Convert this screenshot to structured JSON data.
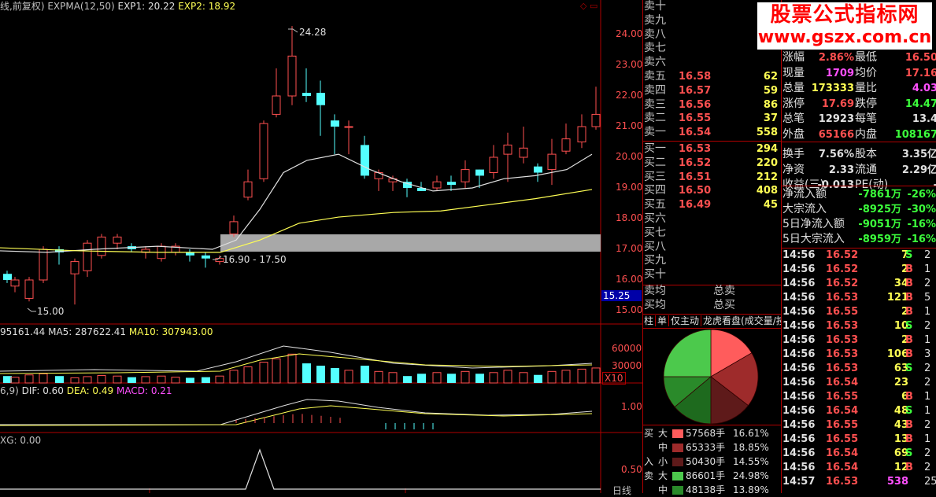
{
  "header": {
    "kline_title": "线,前复权)",
    "expma": "EXPMA(12,50)",
    "exp1": "EXP1: 20.22",
    "exp2": "EXP2: 18.92",
    "vol_title": "95161.44",
    "vol_ma5": "MA5: 287622.41",
    "vol_ma10": "MA10: 307943.00",
    "macd_prefix": "6,9)",
    "macd_dif": "DIF: 0.60",
    "macd_dea": "DEA: 0.49",
    "macd_macd": "MACD: 0.21",
    "xg": "XG: 0.00"
  },
  "price_axis": [
    "24.00",
    "23.00",
    "22.00",
    "21.00",
    "20.00",
    "19.00",
    "18.00",
    "17.00",
    "16.00",
    "15.00"
  ],
  "price_axis_highlight": "15.25",
  "annotations": {
    "high": "24.28",
    "low": "15.00",
    "range": "16.90 - 17.50"
  },
  "vol_axis": [
    "60000",
    "30000"
  ],
  "vol_unit": "X10",
  "macd_axis": "1.00",
  "xg_axis": "0.50",
  "xg_bottom_label": "日线",
  "watermark": {
    "line1": "股票公式指标网",
    "line2": "www.gszx.com.cn"
  },
  "order_book": {
    "sell_labels": [
      "卖十",
      "卖九",
      "卖八",
      "卖七",
      "卖六",
      "卖五",
      "卖四",
      "卖三",
      "卖二",
      "卖一"
    ],
    "sell_prices": [
      "",
      "",
      "",
      "",
      "",
      "16.58",
      "16.57",
      "16.56",
      "16.55",
      "16.54"
    ],
    "sell_vols": [
      "",
      "",
      "",
      "",
      "",
      "62",
      "59",
      "86",
      "37",
      "558"
    ],
    "buy_labels": [
      "买一",
      "买二",
      "买三",
      "买四",
      "买五",
      "买六",
      "买七",
      "买八",
      "买九",
      "买十"
    ],
    "buy_prices": [
      "16.53",
      "16.52",
      "16.51",
      "16.50",
      "16.49",
      "",
      "",
      "",
      "",
      ""
    ],
    "buy_vols": [
      "294",
      "220",
      "212",
      "408",
      "45",
      "",
      "",
      "",
      "",
      ""
    ],
    "sell_avg": "卖均",
    "buy_avg": "买均",
    "total_sell": "总卖",
    "total_buy": "总买"
  },
  "tabs": [
    "柱",
    "单",
    "仅主动",
    "龙虎看盘(成交量/按"
  ],
  "pie_legend": [
    {
      "side": "买",
      "size": "大",
      "amount": "57568手",
      "pct": "16.61%",
      "color": "#ff5c5c"
    },
    {
      "side": "",
      "size": "中",
      "amount": "65333手",
      "pct": "18.85%",
      "color": "#9e2b2b"
    },
    {
      "side": "入",
      "size": "小",
      "amount": "50430手",
      "pct": "14.55%",
      "color": "#5e1a1a"
    },
    {
      "side": "卖",
      "size": "大",
      "amount": "86601手",
      "pct": "24.98%",
      "color": "#4cc94c"
    },
    {
      "side": "",
      "size": "中",
      "amount": "48138手",
      "pct": "13.89%",
      "color": "#2a8a2a"
    }
  ],
  "info_rows": [
    {
      "l1": "涨幅",
      "v1": "2.86%",
      "c1": "red",
      "l2": "最低",
      "v2": "16.50",
      "c2": "red"
    },
    {
      "l1": "现量",
      "v1": "1709",
      "c1": "purple",
      "l2": "均价",
      "v2": "17.16",
      "c2": "red"
    },
    {
      "l1": "总量",
      "v1": "173333",
      "c1": "yellow",
      "l2": "量比",
      "v2": "4.03",
      "c2": "purple"
    },
    {
      "l1": "涨停",
      "v1": "17.69",
      "c1": "red",
      "l2": "跌停",
      "v2": "14.47",
      "c2": "green"
    },
    {
      "l1": "总笔",
      "v1": "12923",
      "c1": "white",
      "l2": "每笔",
      "v2": "13.4",
      "c2": "white"
    },
    {
      "l1": "外盘",
      "v1": "65166",
      "c1": "red",
      "l2": "内盘",
      "v2": "108167",
      "c2": "green"
    },
    {
      "l1": "换手",
      "v1": "7.56%",
      "c1": "white",
      "l2": "股本",
      "v2": "3.35亿",
      "c2": "white"
    },
    {
      "l1": "净资",
      "v1": "2.33",
      "c1": "white",
      "l2": "流通",
      "v2": "2.29亿",
      "c2": "white"
    },
    {
      "l1": "收益(三)",
      "v1": "-0.013",
      "c1": "white",
      "l2": "PE(动)",
      "v2": "-",
      "c2": "white"
    }
  ],
  "flow_rows": [
    {
      "label": "净流入额",
      "value": "-7861万",
      "pct": "-26%"
    },
    {
      "label": "大宗流入",
      "value": "-8925万",
      "pct": "-30%"
    },
    {
      "label": "5日净流入额",
      "value": "-9051万",
      "pct": "-16%"
    },
    {
      "label": "5日大宗流入",
      "value": "-8959万",
      "pct": "-16%"
    }
  ],
  "ticks": [
    {
      "t": "14:56",
      "p": "16.52",
      "v": "7",
      "d": "S",
      "n": "2"
    },
    {
      "t": "14:56",
      "p": "16.52",
      "v": "2",
      "d": "B",
      "n": "1"
    },
    {
      "t": "14:56",
      "p": "16.52",
      "v": "34",
      "d": "B",
      "n": "2"
    },
    {
      "t": "14:56",
      "p": "16.53",
      "v": "121",
      "d": "B",
      "n": "5"
    },
    {
      "t": "14:56",
      "p": "16.55",
      "v": "2",
      "d": "B",
      "n": "1"
    },
    {
      "t": "14:56",
      "p": "16.53",
      "v": "10",
      "d": "S",
      "n": "2"
    },
    {
      "t": "14:56",
      "p": "16.53",
      "v": "2",
      "d": "B",
      "n": "1"
    },
    {
      "t": "14:56",
      "p": "16.53",
      "v": "106",
      "d": "B",
      "n": "3"
    },
    {
      "t": "14:56",
      "p": "16.53",
      "v": "63",
      "d": "S",
      "n": "2"
    },
    {
      "t": "14:56",
      "p": "16.54",
      "v": "23",
      "d": "",
      "n": "2"
    },
    {
      "t": "14:56",
      "p": "16.55",
      "v": "6",
      "d": "B",
      "n": "1"
    },
    {
      "t": "14:56",
      "p": "16.54",
      "v": "48",
      "d": "S",
      "n": "1"
    },
    {
      "t": "14:56",
      "p": "16.55",
      "v": "43",
      "d": "B",
      "n": "2"
    },
    {
      "t": "14:56",
      "p": "16.55",
      "v": "13",
      "d": "B",
      "n": "1"
    },
    {
      "t": "14:56",
      "p": "16.54",
      "v": "69",
      "d": "S",
      "n": "2"
    },
    {
      "t": "14:56",
      "p": "16.54",
      "v": "12",
      "d": "B",
      "n": "2"
    },
    {
      "t": "14:57",
      "p": "16.53",
      "v": "538",
      "d": "",
      "n": "25"
    }
  ]
}
